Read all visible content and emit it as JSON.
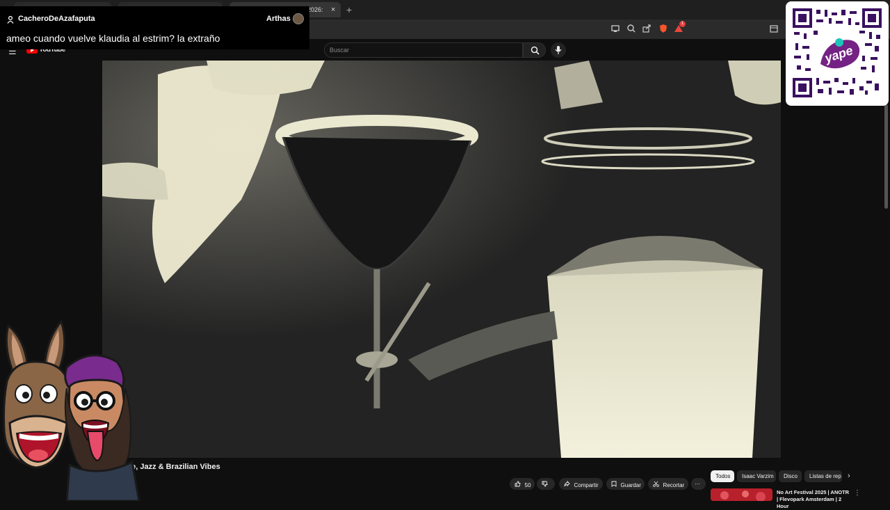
{
  "browser": {
    "tabs": [
      {
        "label": "",
        "active": false
      },
      {
        "label": "",
        "active": false
      },
      {
        "label": "2026: ",
        "active": true
      }
    ],
    "new_tab_symbol": "+",
    "tab_close_symbol": "×",
    "toolbar_icons": [
      "cast-icon",
      "zoom-icon",
      "share-icon",
      "brave-shields-icon",
      "brave-rewards-icon",
      "tab-search-icon"
    ],
    "rewards_badge": "1"
  },
  "chat": {
    "username": "CacheroDeAzafaputa",
    "streamer": "Arthas",
    "message": "ameo cuando vuelve klaudia al estrim? la extraño"
  },
  "youtube": {
    "wordmark": "YouTube",
    "search_placeholder": "Buscar",
    "video_title": "se, Jazz & Brazilian Vibes",
    "actions": {
      "like_count": "50",
      "share": "Compartir",
      "save": "Guardar",
      "clip": "Recortar",
      "more": "···"
    },
    "chips": [
      {
        "label": "Todos",
        "active": true
      },
      {
        "label": "Isaac Varzim",
        "active": false
      },
      {
        "label": "Disco",
        "active": false
      },
      {
        "label": "Listas de rep",
        "active": false
      }
    ],
    "recommendation": {
      "title": "No Art Festival 2025 | ANOTR | Flevopark Amsterdam | 2 Hour"
    }
  },
  "donation": {
    "brand": "yape",
    "brand_color": "#742284"
  }
}
